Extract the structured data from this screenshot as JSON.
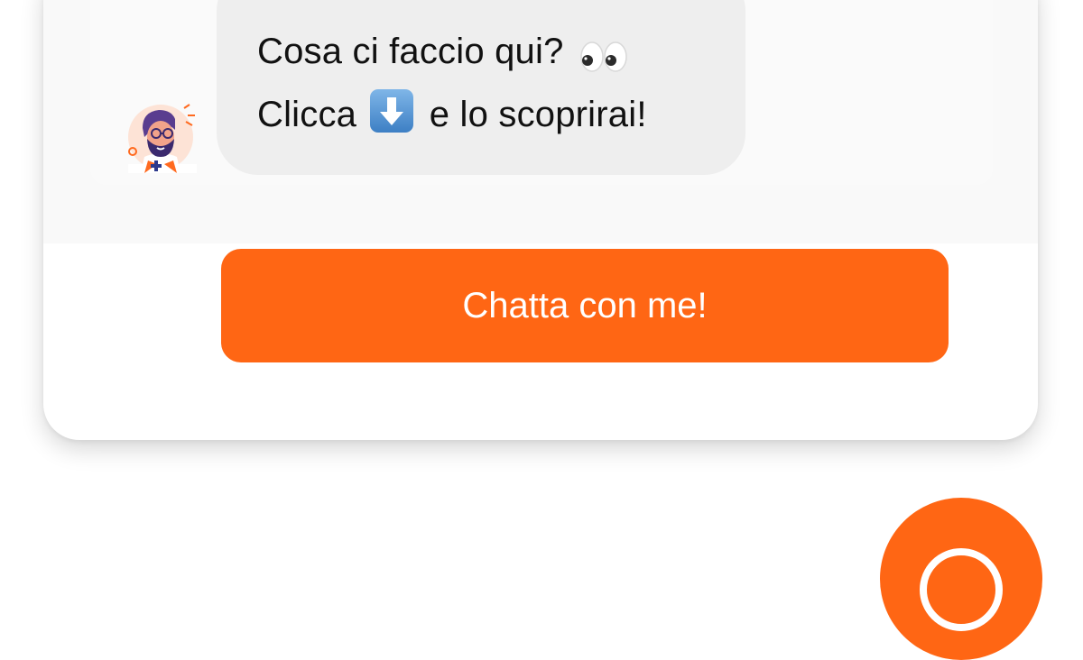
{
  "chat_widget": {
    "message": {
      "line1": "Cosa ci faccio qui?",
      "line1_emoji": "eyes-emoji",
      "line2_start": "Clicca",
      "line2_emoji": "down-arrow-emoji",
      "line2_end": "e lo scoprirai!"
    },
    "avatar_icon": "bearded-man-avatar",
    "cta_label": "Chatta con me!",
    "launcher_icon": "chat-bubble-icon"
  },
  "colors": {
    "accent": "#ff6614",
    "bubble": "#eeeeee",
    "text": "#111111",
    "button_text": "#ffffff"
  }
}
